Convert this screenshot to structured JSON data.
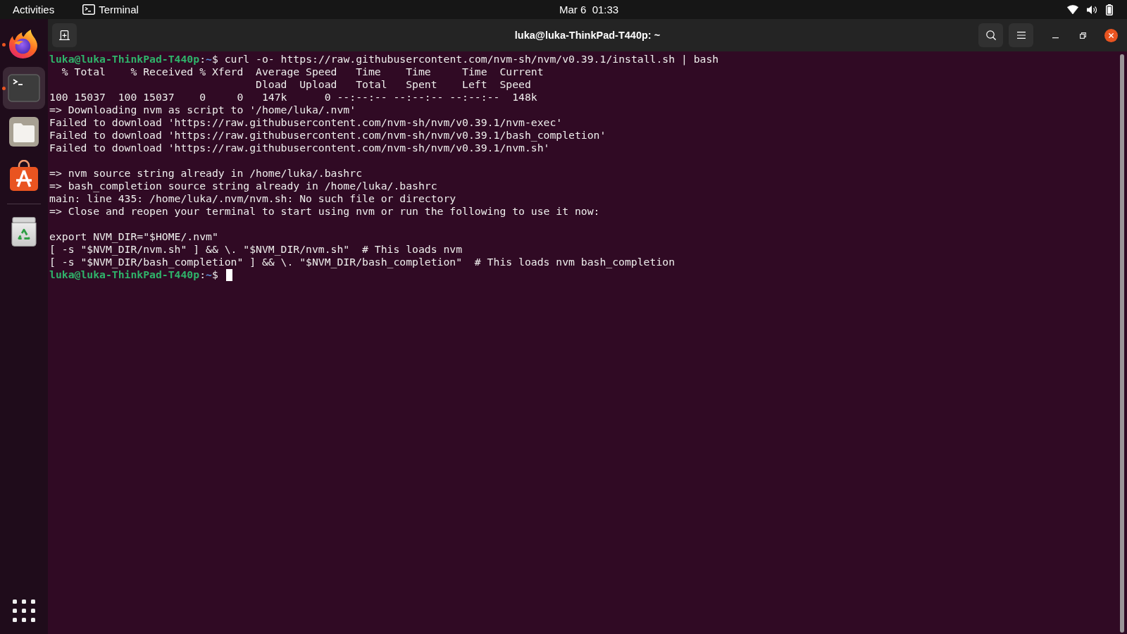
{
  "top_bar": {
    "activities": "Activities",
    "app_menu": "Terminal",
    "clock": "Mar 6  01:33"
  },
  "dock": {
    "favorites": [
      {
        "kind": "browser",
        "running": true,
        "selected": false
      },
      {
        "kind": "terminal",
        "running": true,
        "selected": true
      },
      {
        "kind": "files",
        "running": false,
        "selected": false
      },
      {
        "kind": "software",
        "running": false,
        "selected": false
      }
    ],
    "extras": [
      {
        "kind": "trash",
        "running": false,
        "selected": false
      }
    ]
  },
  "window": {
    "title": "luka@luka-ThinkPad-T440p: ~"
  },
  "terminal": {
    "lines": [
      {
        "kind": "prompt",
        "user_host": "luka@luka-ThinkPad-T440p",
        "separator": ":",
        "path": "~",
        "symbol": "$",
        "command": "curl -o- https://raw.githubusercontent.com/nvm-sh/nvm/v0.39.1/install.sh | bash",
        "cursor": false
      },
      {
        "kind": "output",
        "text": "  % Total    % Received % Xferd  Average Speed   Time    Time     Time  Current"
      },
      {
        "kind": "output",
        "text": "                                 Dload  Upload   Total   Spent    Left  Speed"
      },
      {
        "kind": "output",
        "text": "100 15037  100 15037    0     0   147k      0 --:--:-- --:--:-- --:--:--  148k"
      },
      {
        "kind": "output",
        "text": "=> Downloading nvm as script to '/home/luka/.nvm'"
      },
      {
        "kind": "output",
        "text": "Failed to download 'https://raw.githubusercontent.com/nvm-sh/nvm/v0.39.1/nvm-exec'"
      },
      {
        "kind": "output",
        "text": "Failed to download 'https://raw.githubusercontent.com/nvm-sh/nvm/v0.39.1/bash_completion'"
      },
      {
        "kind": "output",
        "text": "Failed to download 'https://raw.githubusercontent.com/nvm-sh/nvm/v0.39.1/nvm.sh'"
      },
      {
        "kind": "blank"
      },
      {
        "kind": "output",
        "text": "=> nvm source string already in /home/luka/.bashrc"
      },
      {
        "kind": "output",
        "text": "=> bash_completion source string already in /home/luka/.bashrc"
      },
      {
        "kind": "output",
        "text": "main: line 435: /home/luka/.nvm/nvm.sh: No such file or directory"
      },
      {
        "kind": "output",
        "text": "=> Close and reopen your terminal to start using nvm or run the following to use it now:"
      },
      {
        "kind": "blank"
      },
      {
        "kind": "output",
        "text": "export NVM_DIR=\"$HOME/.nvm\""
      },
      {
        "kind": "output",
        "text": "[ -s \"$NVM_DIR/nvm.sh\" ] && \\. \"$NVM_DIR/nvm.sh\"  # This loads nvm"
      },
      {
        "kind": "output",
        "text": "[ -s \"$NVM_DIR/bash_completion\" ] && \\. \"$NVM_DIR/bash_completion\"  # This loads nvm bash_completion"
      },
      {
        "kind": "prompt",
        "user_host": "luka@luka-ThinkPad-T440p",
        "separator": ":",
        "path": "~",
        "symbol": "$",
        "cursor": true
      }
    ]
  }
}
